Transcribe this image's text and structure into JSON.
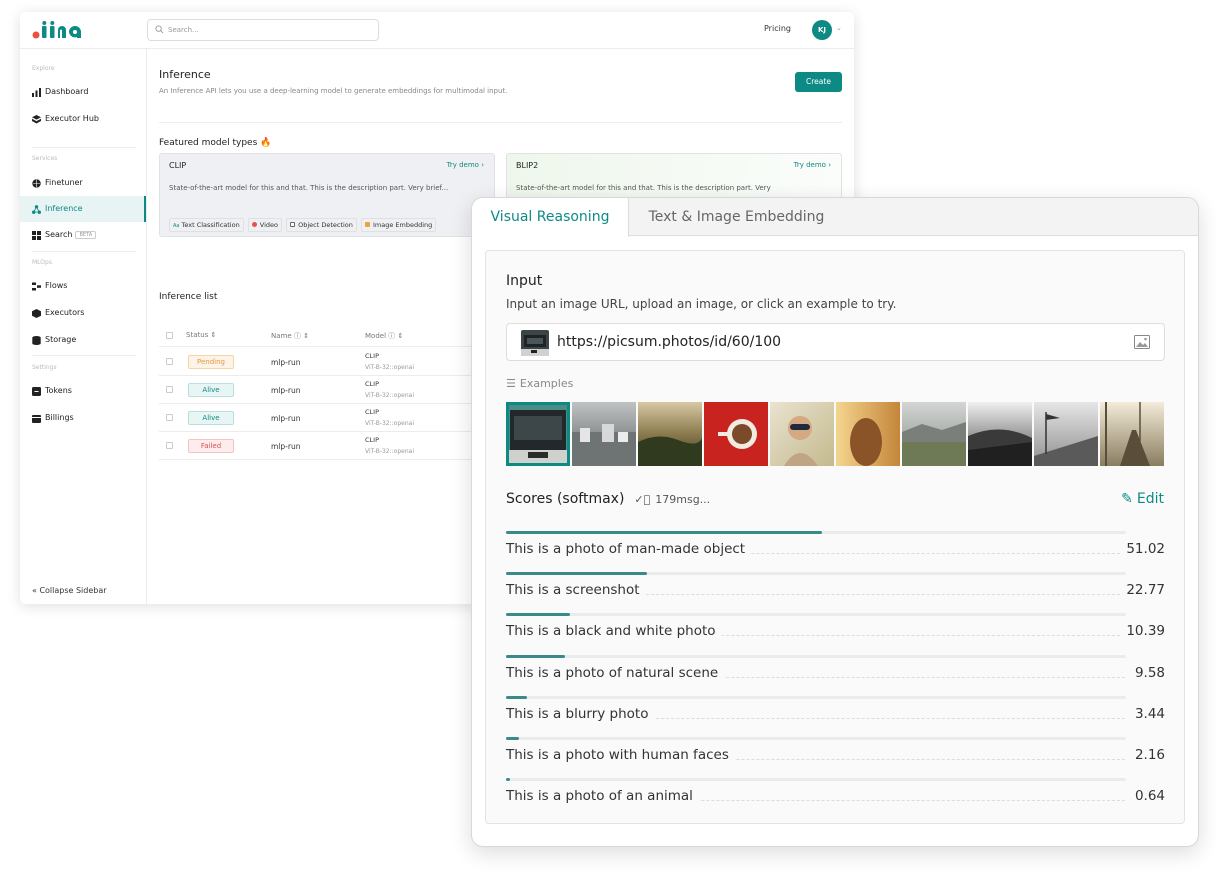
{
  "dashboard": {
    "logo": "jina",
    "search_placeholder": "Search...",
    "pricing": "Pricing",
    "avatar": "KJ",
    "sidebar": {
      "section_explore": "Explore",
      "dashboard": "Dashboard",
      "executor_hub": "Executor Hub",
      "section_services": "Services",
      "finetuner": "Finetuner",
      "inference": "Inference",
      "search": "Search",
      "beta": "BETA",
      "section_mlops": "MLOps",
      "flows": "Flows",
      "executors": "Executors",
      "storage": "Storage",
      "section_settings": "Settings",
      "tokens": "Tokens",
      "billings": "Billings",
      "collapse": "Collapse Sidebar"
    },
    "main": {
      "title": "Inference",
      "subtitle": "An Inference API lets you use a deep-learning model to generate embeddings for multimodal input.",
      "create": "Create",
      "featured": "Featured model types 🔥",
      "cards": [
        {
          "title": "CLIP",
          "try": "Try demo  ›",
          "desc": "State-of-the-art model for this and that. This is the description part. Very brief..."
        },
        {
          "title": "BLIP2",
          "try": "Try demo  ›",
          "desc": "State-of-the-art model for this and that. This is the description part. Very"
        }
      ],
      "tags": [
        "Text Classification",
        "Video",
        "Object Detection",
        "Image Embedding"
      ],
      "list_title": "Inference list",
      "columns": [
        "Status  ⇕",
        "Name ⓘ  ⇕",
        "Model ⓘ  ⇕"
      ],
      "rows": [
        {
          "status": "Pending",
          "name": "mlp-run",
          "model": "CLIP",
          "variant": "ViT-B-32::openai"
        },
        {
          "status": "Alive",
          "name": "mlp-run",
          "model": "CLIP",
          "variant": "ViT-B-32::openai"
        },
        {
          "status": "Alive",
          "name": "mlp-run",
          "model": "CLIP",
          "variant": "ViT-B-32::openai"
        },
        {
          "status": "Failed",
          "name": "mlp-run",
          "model": "CLIP",
          "variant": "ViT-B-32::openai"
        }
      ]
    }
  },
  "front": {
    "tabs": [
      "Visual Reasoning",
      "Text & Image Embedding"
    ],
    "input_title": "Input",
    "input_sub": "Input an image URL, upload an image, or click an example to try.",
    "url": "https://picsum.photos/id/60/100",
    "examples_label": "Examples",
    "scores_title": "Scores (softmax)",
    "scores_time": "179msg...",
    "edit": "Edit",
    "scores": [
      {
        "label": "This is a photo of man-made object",
        "value": "51.02",
        "pct": 51.02
      },
      {
        "label": "This is a screenshot",
        "value": "22.77",
        "pct": 22.77
      },
      {
        "label": "This is a black and white photo",
        "value": "10.39",
        "pct": 10.39
      },
      {
        "label": "This is a photo of natural scene",
        "value": "9.58",
        "pct": 9.58
      },
      {
        "label": "This is a blurry photo",
        "value": "3.44",
        "pct": 3.44
      },
      {
        "label": "This is a photo with human faces",
        "value": "2.16",
        "pct": 2.16
      },
      {
        "label": "This is a photo of an animal",
        "value": "0.64",
        "pct": 0.64
      }
    ],
    "accent": "#0e8a85"
  }
}
